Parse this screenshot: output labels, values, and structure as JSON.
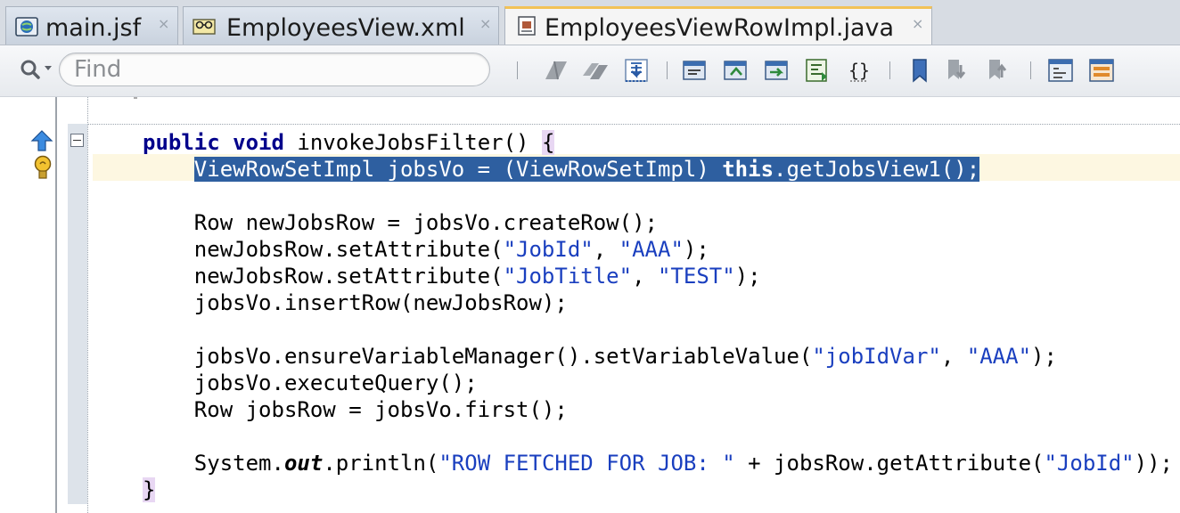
{
  "tabs": [
    {
      "label": "main.jsf",
      "icon": "jsf-globe-icon",
      "active": false
    },
    {
      "label": "EmployeesView.xml",
      "icon": "view-object-icon",
      "active": false
    },
    {
      "label": "EmployeesViewRowImpl.java",
      "icon": "java-file-icon",
      "active": true
    }
  ],
  "close_glyph": "×",
  "toolbar": {
    "search_placeholder": "Find",
    "search_value": "",
    "buttons": [
      "previous-bookmark-icon",
      "next-bookmark-icon",
      "go-to-line-icon",
      "code-template-icon",
      "toggle-comment-icon",
      "surround-icon",
      "reformat-icon",
      "braces-icon",
      "toggle-bookmark-icon",
      "prev-bookmark-icon",
      "next-bookmark-nav-icon",
      "shift-left-icon",
      "shift-right-icon"
    ]
  },
  "colors": {
    "keyword": "#00008b",
    "string": "#1a3fbf",
    "selection": "#2e5fa0",
    "current_line": "#fdf7e1",
    "brace_match": "#e8d7f3",
    "active_tab_accent": "#f2c256"
  },
  "gutter": {
    "override_icon": "override-up-arrow-icon",
    "hint_icon": "lightbulb-hint-icon",
    "fold_icon": "fold-collapse-icon"
  },
  "code": {
    "l1_public": "public",
    "l1_void": "void",
    "l1_rest": " invokeJobsFilter() ",
    "l1_brace": "{",
    "l2_indent": "    ",
    "l2_sel_a": "ViewRowSetImpl jobsVo = (ViewRowSetImpl) ",
    "l2_this": "this",
    "l2_sel_b": ".getJobsView1();",
    "l3": "    Row newJobsRow = jobsVo.createRow();",
    "l4_a": "    newJobsRow.setAttribute(",
    "l4_s1": "\"JobId\"",
    "l4_b": ", ",
    "l4_s2": "\"AAA\"",
    "l4_c": ");",
    "l5_a": "    newJobsRow.setAttribute(",
    "l5_s1": "\"JobTitle\"",
    "l5_b": ", ",
    "l5_s2": "\"TEST\"",
    "l5_c": ");",
    "l6": "    jobsVo.insertRow(newJobsRow);",
    "l7_a": "    jobsVo.ensureVariableManager().setVariableValue(",
    "l7_s1": "\"jobIdVar\"",
    "l7_b": ", ",
    "l7_s2": "\"AAA\"",
    "l7_c": ");",
    "l8": "    jobsVo.executeQuery();",
    "l9": "    Row jobsRow = jobsVo.first();",
    "l10_a": "    System.",
    "l10_out": "out",
    "l10_b": ".println(",
    "l10_s1": "\"ROW FETCHED FOR JOB: \"",
    "l10_c": " + jobsRow.getAttribute(",
    "l10_s2": "\"JobId\"",
    "l10_d": "));",
    "l11_brace": "}"
  }
}
